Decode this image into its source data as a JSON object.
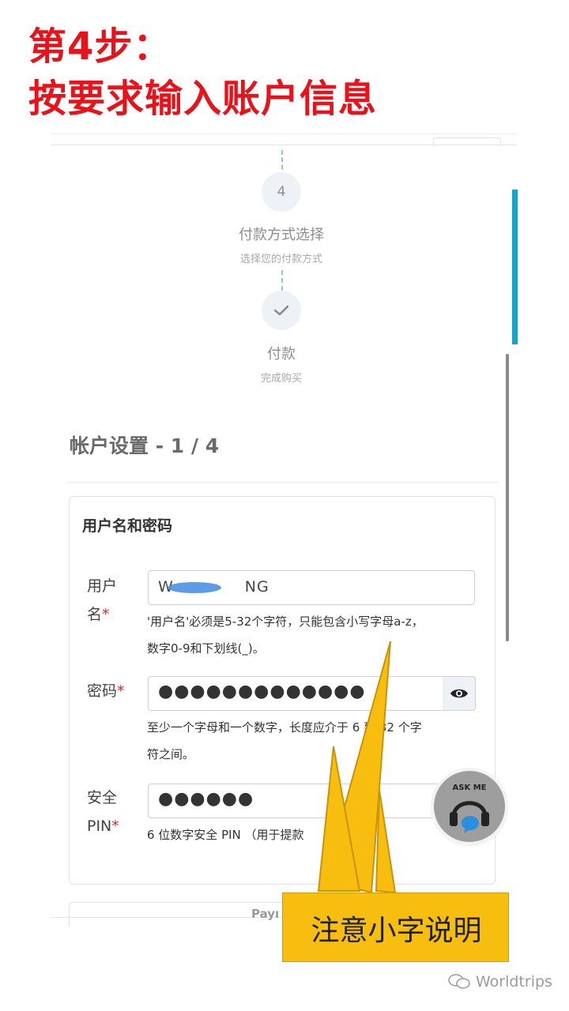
{
  "headline": {
    "line1": "第4步：",
    "line2": "按要求输入账户信息"
  },
  "steps": [
    {
      "number": "4",
      "title": "付款方式选择",
      "subtitle": "选择您的付款方式"
    },
    {
      "icon": "check-icon",
      "title": "付款",
      "subtitle": "完成购买"
    }
  ],
  "section": {
    "title": "帐户设置 - 1 / 4"
  },
  "card": {
    "title": "用户名和密码",
    "username": {
      "label_line1": "用户",
      "label_line2": "名",
      "required": "*",
      "value": "W",
      "value_suffix": "NG",
      "hint_line1": "'用户名'必须是5-32个字符，只能包含小写字母a-z，",
      "hint_line2": "数字0-9和下划线(_)。"
    },
    "password": {
      "label": "密码",
      "required": "*",
      "value": "●●●●●●●●●●●●●",
      "hint_line1": "至少一个字母和一个数字，长度应介于 6 到 32 个字",
      "hint_line2": "符之间。"
    },
    "pin": {
      "label_line1": "安全",
      "label_line2": "PIN",
      "required": "*",
      "value": "●●●●●●",
      "hint": "6 位数字安全 PIN （用于提款"
    }
  },
  "next_card_label": "Payı",
  "askme": {
    "label": "ASK ME",
    "icon": "headset-icon"
  },
  "callout": {
    "text": "注意小字说明"
  },
  "watermark": {
    "text": "Worldtrips",
    "icon": "wechat-icon"
  },
  "colors": {
    "headline": "#e8121b",
    "callout": "#f7bd0f",
    "accent": "#1aa3c8",
    "required": "#d9262e"
  }
}
